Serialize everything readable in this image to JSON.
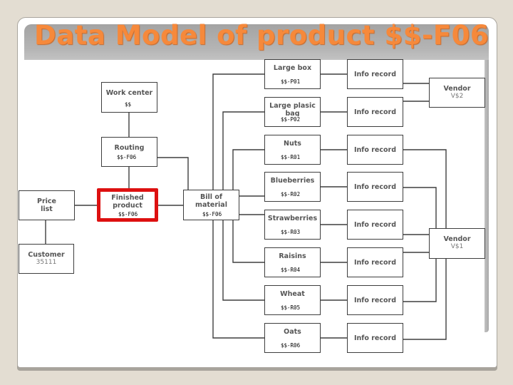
{
  "slide": {
    "title": "Data Model of product $$-F06"
  },
  "diagram": {
    "work_center": {
      "label": "Work center",
      "code": "$$"
    },
    "routing": {
      "label": "Routing",
      "code": "$$-F06"
    },
    "price_list": {
      "label": "Price list"
    },
    "customer": {
      "label": "Customer",
      "id": "35111"
    },
    "finished_product": {
      "label": "Finished product",
      "code": "$$-F06",
      "highlight_color": "#dd1010"
    },
    "bill_of_material": {
      "label": "Bill of material",
      "code": "$$-F06"
    },
    "materials": [
      {
        "label": "Large box",
        "code": "$$-P01",
        "info_record": "Info record",
        "vendor": "V$2"
      },
      {
        "label": "Large plasic bag",
        "code": "$$-P02",
        "info_record": "Info record",
        "vendor": "V$2"
      },
      {
        "label": "Nuts",
        "code": "$$-R01",
        "info_record": "Info record",
        "vendor": "V$1"
      },
      {
        "label": "Blueberries",
        "code": "$$-R02",
        "info_record": "Info record",
        "vendor": "V$1"
      },
      {
        "label": "Strawberries",
        "code": "$$-R03",
        "info_record": "Info record",
        "vendor": "V$1"
      },
      {
        "label": "Raisins",
        "code": "$$-R04",
        "info_record": "Info record",
        "vendor": "V$1"
      },
      {
        "label": "Wheat",
        "code": "$$-R05",
        "info_record": "Info record",
        "vendor": "V$1"
      },
      {
        "label": "Oats",
        "code": "$$-R06",
        "info_record": "Info record",
        "vendor": "V$1"
      }
    ],
    "vendors": [
      {
        "label": "Vendor",
        "id": "V$2"
      },
      {
        "label": "Vendor",
        "id": "V$1"
      }
    ]
  }
}
